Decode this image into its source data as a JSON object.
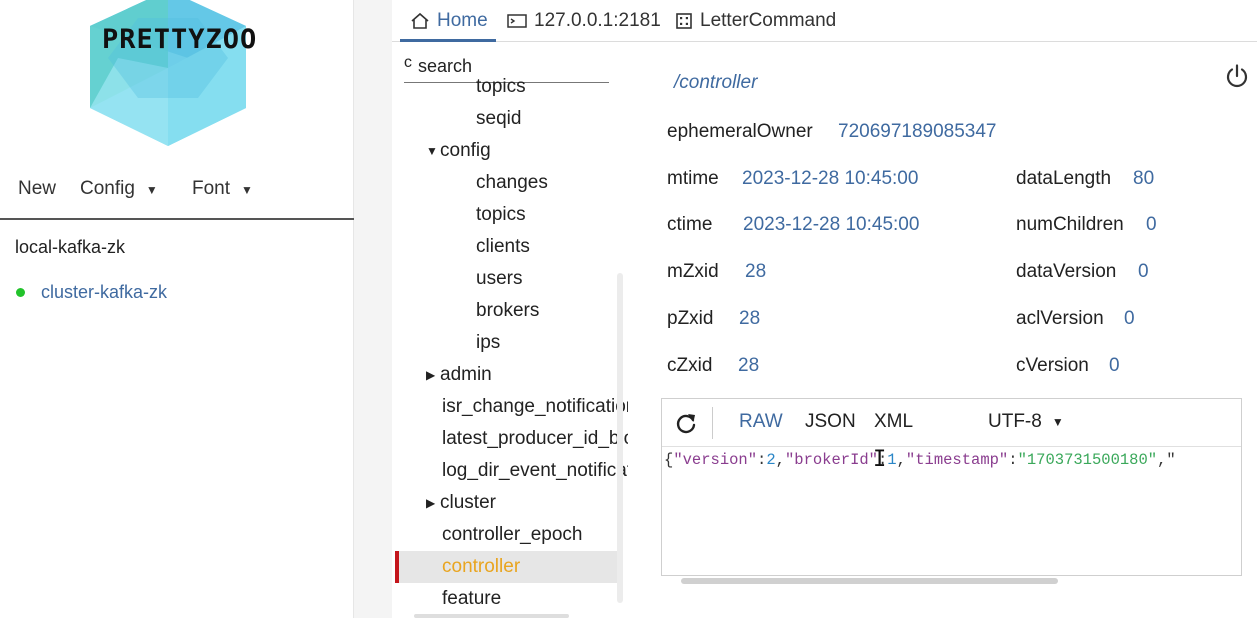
{
  "app": {
    "logo_text": "PRETTYZOO",
    "menu": [
      {
        "label": "New",
        "has_dropdown": false
      },
      {
        "label": "Config",
        "has_dropdown": true
      },
      {
        "label": "Font",
        "has_dropdown": true
      }
    ],
    "servers": [
      {
        "name": "local-kafka-zk",
        "connected": false
      },
      {
        "name": "cluster-kafka-zk",
        "connected": true
      }
    ]
  },
  "tabs": [
    {
      "label": "Home",
      "icon": "home-icon",
      "active": true
    },
    {
      "label": "127.0.0.1:2181",
      "icon": "terminal-icon",
      "active": false
    },
    {
      "label": "LetterCommand",
      "icon": "command-icon",
      "active": false
    }
  ],
  "tree": {
    "search_placeholder": "search",
    "nodes": [
      {
        "label": "topics",
        "depth": 2,
        "arrow": ""
      },
      {
        "label": "seqid",
        "depth": 2,
        "arrow": ""
      },
      {
        "label": "config",
        "depth": 1,
        "arrow": "expanded"
      },
      {
        "label": "changes",
        "depth": 2,
        "arrow": ""
      },
      {
        "label": "topics",
        "depth": 2,
        "arrow": ""
      },
      {
        "label": "clients",
        "depth": 2,
        "arrow": ""
      },
      {
        "label": "users",
        "depth": 2,
        "arrow": ""
      },
      {
        "label": "brokers",
        "depth": 2,
        "arrow": ""
      },
      {
        "label": "ips",
        "depth": 2,
        "arrow": ""
      },
      {
        "label": "admin",
        "depth": 1,
        "arrow": "collapsed"
      },
      {
        "label": "isr_change_notification",
        "depth": 1,
        "arrow": ""
      },
      {
        "label": "latest_producer_id_block",
        "depth": 1,
        "arrow": ""
      },
      {
        "label": "log_dir_event_notification",
        "depth": 1,
        "arrow": ""
      },
      {
        "label": "cluster",
        "depth": 1,
        "arrow": "collapsed"
      },
      {
        "label": "controller_epoch",
        "depth": 1,
        "arrow": ""
      },
      {
        "label": "controller",
        "depth": 1,
        "arrow": "",
        "selected": true
      },
      {
        "label": "feature",
        "depth": 1,
        "arrow": ""
      }
    ]
  },
  "detail": {
    "path": "/controller",
    "ephemeral_owner_label": "ephemeralOwner",
    "ephemeral_owner_value": "720697189085347",
    "left_stats": [
      {
        "label": "mtime",
        "value": "2023-12-28 10:45:00"
      },
      {
        "label": "ctime",
        "value": "2023-12-28 10:45:00"
      },
      {
        "label": "mZxid",
        "value": "28"
      },
      {
        "label": "pZxid",
        "value": "28"
      },
      {
        "label": "cZxid",
        "value": "28"
      }
    ],
    "right_stats": [
      {
        "label": "dataLength",
        "value": "80"
      },
      {
        "label": "numChildren",
        "value": "0"
      },
      {
        "label": "dataVersion",
        "value": "0"
      },
      {
        "label": "aclVersion",
        "value": "0"
      },
      {
        "label": "cVersion",
        "value": "0"
      }
    ]
  },
  "editor": {
    "formats": [
      "RAW",
      "JSON",
      "XML"
    ],
    "active_format": "RAW",
    "encoding": "UTF-8",
    "tokens": [
      {
        "t": "p",
        "v": "{"
      },
      {
        "t": "key",
        "v": "\"version\""
      },
      {
        "t": "p",
        "v": ":"
      },
      {
        "t": "num",
        "v": "2"
      },
      {
        "t": "p",
        "v": ","
      },
      {
        "t": "key",
        "v": "\"brokerId\""
      },
      {
        "t": "p",
        "v": ":"
      },
      {
        "t": "num",
        "v": "1"
      },
      {
        "t": "p",
        "v": ","
      },
      {
        "t": "key",
        "v": "\"timestamp\""
      },
      {
        "t": "p",
        "v": ":"
      },
      {
        "t": "str",
        "v": "\"1703731500180\""
      },
      {
        "t": "p",
        "v": ",\""
      }
    ]
  },
  "colors": {
    "accent": "#3f6aa0",
    "selected_text": "#e9a520",
    "selected_marker": "#c4161c",
    "connected_dot": "#22c32b"
  }
}
